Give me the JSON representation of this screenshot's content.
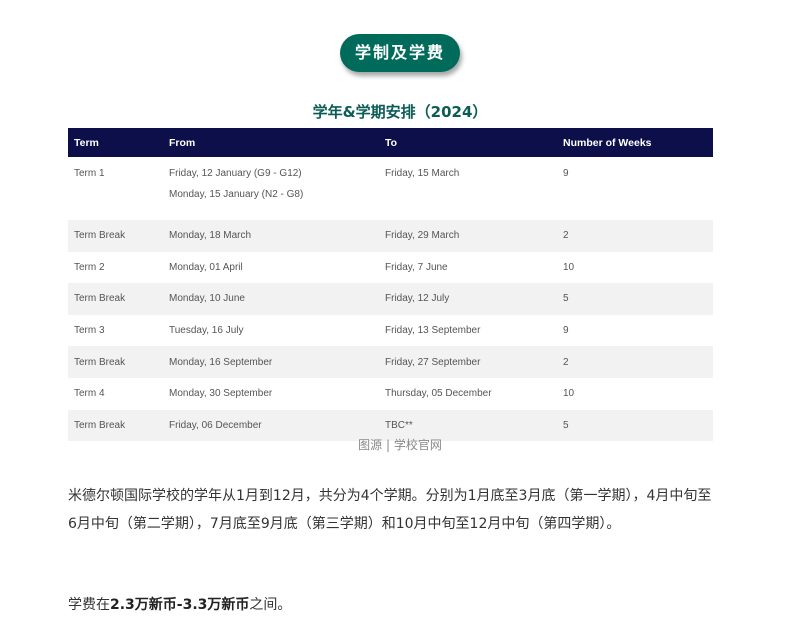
{
  "section_badge": "学制及学费",
  "table_title": "学年&学期安排（2024）",
  "table": {
    "headers": [
      "Term",
      "From",
      "To",
      "Number of Weeks"
    ],
    "rows": [
      {
        "term": "Term 1",
        "from": "Friday, 12 January (G9 - G12)",
        "from_line2": "Monday, 15 January (N2 - G8)",
        "to": "Friday, 15 March",
        "weeks": "9"
      },
      {
        "term": "Term Break",
        "from": "Monday, 18 March",
        "to": "Friday, 29 March",
        "weeks": "2"
      },
      {
        "term": "Term 2",
        "from": "Monday, 01 April",
        "to": "Friday, 7 June",
        "weeks": "10"
      },
      {
        "term": "Term Break",
        "from": "Monday, 10 June",
        "to": "Friday, 12 July",
        "weeks": "5"
      },
      {
        "term": "Term 3",
        "from": "Tuesday, 16 July",
        "to": "Friday, 13 September",
        "weeks": "9"
      },
      {
        "term": "Term Break",
        "from": "Monday, 16 September",
        "to": "Friday, 27 September",
        "weeks": "2"
      },
      {
        "term": "Term 4",
        "from": "Monday, 30 September",
        "to": "Thursday, 05 December",
        "weeks": "10"
      },
      {
        "term": "Term Break",
        "from": "Friday, 06 December",
        "to": "TBC**",
        "weeks": "5"
      }
    ]
  },
  "caption": "图源 | 学校官网",
  "paragraph1": "米德尔顿国际学校的学年从1月到12月，共分为4个学期。分别为1月底至3月底（第一学期），4月中旬至6月中旬（第二学期），7月底至9月底（第三学期）和10月中旬至12月中旬（第四学期）。",
  "paragraph2": {
    "prefix": "学费在",
    "bold": "2.3万新币-3.3万新币",
    "suffix": "之间。"
  }
}
